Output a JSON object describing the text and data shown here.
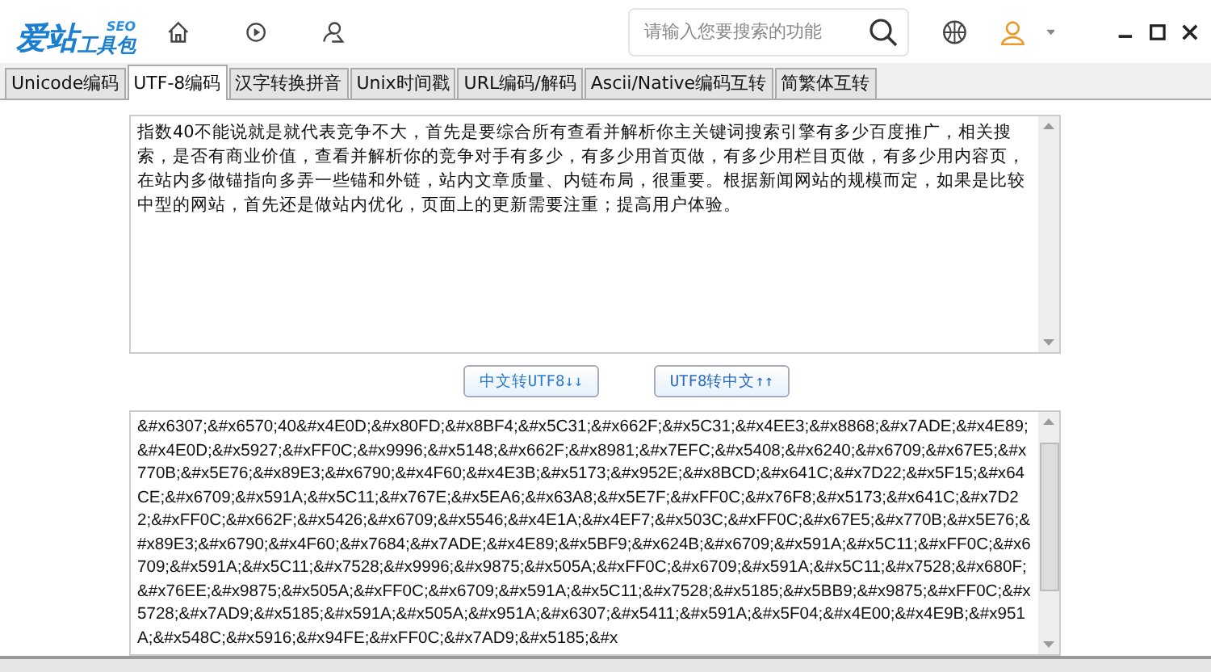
{
  "header": {
    "logo_main": "爱站",
    "logo_sub": "工具包",
    "logo_badge": "SEO",
    "search": {
      "placeholder": "请输入您要搜索的功能"
    }
  },
  "tabs": [
    {
      "label": "Unicode编码",
      "selected": false
    },
    {
      "label": "UTF-8编码",
      "selected": true
    },
    {
      "label": "汉字转换拼音",
      "selected": false
    },
    {
      "label": "Unix时间戳",
      "selected": false
    },
    {
      "label": "URL编码/解码",
      "selected": false
    },
    {
      "label": "Ascii/Native编码互转",
      "selected": false
    },
    {
      "label": "简繁体互转",
      "selected": false
    }
  ],
  "input_text": "指数40不能说就是就代表竞争不大，首先是要综合所有查看并解析你主关键词搜索引擎有多少百度推广，相关搜索，是否有商业价值，查看并解析你的竞争对手有多少，有多少用首页做，有多少用栏目页做，有多少用内容页，在站内多做锚指向多弄一些锚和外链，站内文章质量、内链布局，很重要。根据新闻网站的规模而定，如果是比较中型的网站，首先还是做站内优化，页面上的更新需要注重；提高用户体验。",
  "buttons": [
    {
      "label": "中文转UTF8↓↓",
      "kind": "down"
    },
    {
      "label": "UTF8转中文↑↑",
      "kind": "up"
    }
  ],
  "output_text": "&#x6307;&#x6570;40&#x4E0D;&#x80FD;&#x8BF4;&#x5C31;&#x662F;&#x5C31;&#x4EE3;&#x8868;&#x7ADE;&#x4E89;&#x4E0D;&#x5927;&#xFF0C;&#x9996;&#x5148;&#x662F;&#x8981;&#x7EFC;&#x5408;&#x6240;&#x6709;&#x67E5;&#x770B;&#x5E76;&#x89E3;&#x6790;&#x4F60;&#x4E3B;&#x5173;&#x952E;&#x8BCD;&#x641C;&#x7D22;&#x5F15;&#x64CE;&#x6709;&#x591A;&#x5C11;&#x767E;&#x5EA6;&#x63A8;&#x5E7F;&#xFF0C;&#x76F8;&#x5173;&#x641C;&#x7D22;&#xFF0C;&#x662F;&#x5426;&#x6709;&#x5546;&#x4E1A;&#x4EF7;&#x503C;&#xFF0C;&#x67E5;&#x770B;&#x5E76;&#x89E3;&#x6790;&#x4F60;&#x7684;&#x7ADE;&#x4E89;&#x5BF9;&#x624B;&#x6709;&#x591A;&#x5C11;&#xFF0C;&#x6709;&#x591A;&#x5C11;&#x7528;&#x9996;&#x9875;&#x505A;&#xFF0C;&#x6709;&#x591A;&#x5C11;&#x7528;&#x680F;&#x76EE;&#x9875;&#x505A;&#xFF0C;&#x6709;&#x591A;&#x5C11;&#x7528;&#x5185;&#x5BB9;&#x9875;&#xFF0C;&#x5728;&#x7AD9;&#x5185;&#x591A;&#x505A;&#x951A;&#x6307;&#x5411;&#x591A;&#x5F04;&#x4E00;&#x4E9B;&#x951A;&#x548C;&#x5916;&#x94FE;&#xFF0C;&#x7AD9;&#x5185;&#x"
}
